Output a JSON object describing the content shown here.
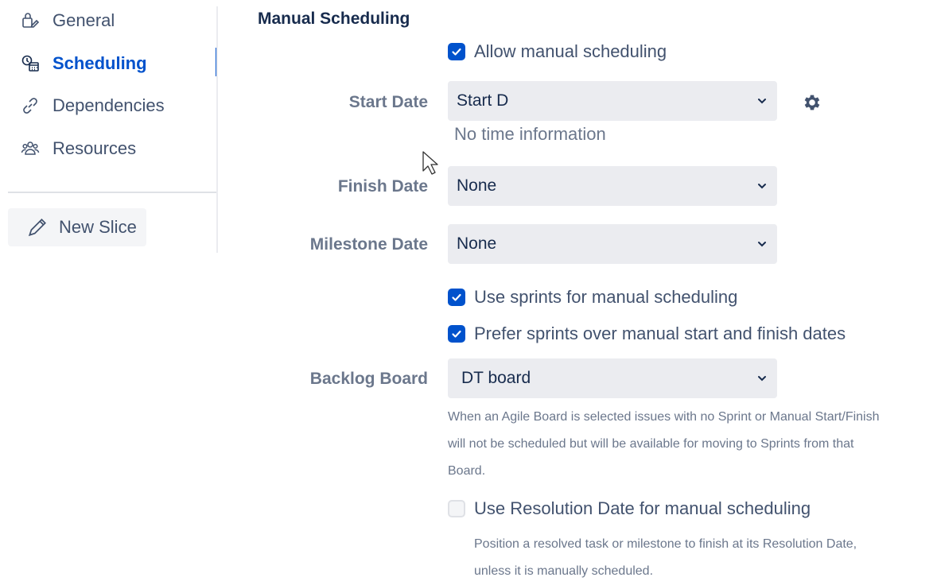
{
  "sidebar": {
    "items": [
      {
        "label": "General",
        "icon": "general-settings-icon"
      },
      {
        "label": "Scheduling",
        "icon": "scheduling-calendar-icon",
        "active": true
      },
      {
        "label": "Dependencies",
        "icon": "link-icon"
      },
      {
        "label": "Resources",
        "icon": "people-icon"
      }
    ],
    "new_slice_label": "New Slice"
  },
  "main": {
    "section_title": "Manual Scheduling",
    "allow_manual_label": "Allow manual scheduling",
    "start_date": {
      "label": "Start Date",
      "value": "Start D",
      "helper": "No time information"
    },
    "finish_date": {
      "label": "Finish Date",
      "value": "None"
    },
    "milestone_date": {
      "label": "Milestone Date",
      "value": "None"
    },
    "use_sprints_label": "Use sprints for manual scheduling",
    "prefer_sprints_label": "Prefer sprints over manual start and finish dates",
    "backlog_board": {
      "label": "Backlog Board",
      "value": "DT board",
      "description_lines": [
        "When an Agile Board is selected issues with no Sprint or Manual Start/Finish",
        "will not be scheduled but will be available for moving to Sprints from that",
        "Board."
      ]
    },
    "resolution_label": "Use Resolution Date for manual scheduling",
    "resolution_description_lines": [
      "Position a resolved task or milestone to finish at its Resolution Date,",
      "unless it is manually scheduled."
    ]
  },
  "colors": {
    "accent": "#0052cc",
    "select_bg": "#ebecf0",
    "muted_text": "#6b778c"
  }
}
